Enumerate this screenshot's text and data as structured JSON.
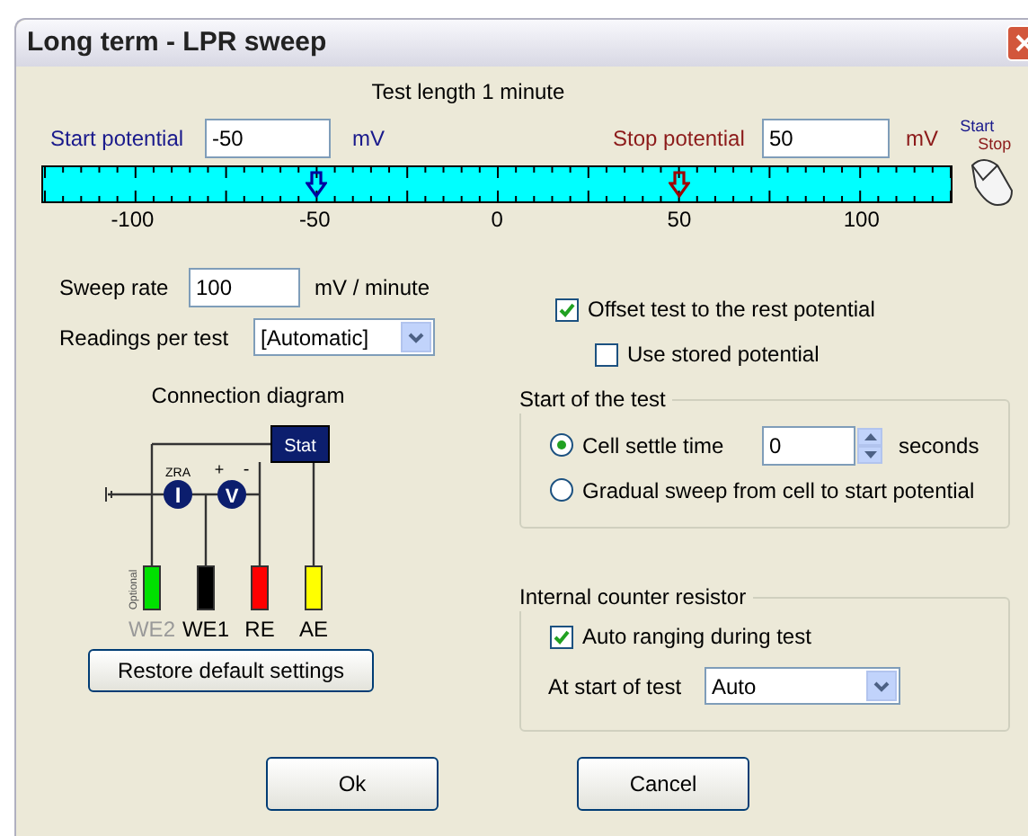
{
  "window": {
    "title": "Long term - LPR sweep"
  },
  "test_length": "Test length 1 minute",
  "start_potential": {
    "label": "Start potential",
    "value": "-50",
    "unit": "mV"
  },
  "stop_potential": {
    "label": "Stop potential",
    "value": "50",
    "unit": "mV"
  },
  "mouse_hint": {
    "start": "Start",
    "stop": "Stop"
  },
  "ruler": {
    "ticks": [
      "-100",
      "-50",
      "0",
      "50",
      "100"
    ],
    "markers": [
      {
        "level": 0.3,
        "color": "#0000a0"
      },
      {
        "level": 0.7,
        "color": "#a00000"
      }
    ]
  },
  "sweep_rate": {
    "label": "Sweep rate",
    "value": "100",
    "unit": "mV / minute"
  },
  "readings_per_test": {
    "label": "Readings per test",
    "value": "[Automatic]"
  },
  "connection_diagram": {
    "title": "Connection diagram",
    "stat": "Stat",
    "zra": "ZRA",
    "ammeter": "I",
    "voltmeter": "V",
    "plus": "+",
    "minus": "-",
    "optional": "Optional",
    "terminals": [
      {
        "label": "WE2",
        "color": "#00e000",
        "optional": true
      },
      {
        "label": "WE1",
        "color": "#000000",
        "optional": false
      },
      {
        "label": "RE",
        "color": "#ff0000",
        "optional": false
      },
      {
        "label": "AE",
        "color": "#ffff00",
        "optional": false
      }
    ]
  },
  "restore_button": "Restore default settings",
  "offset_test": {
    "label": "Offset test to the rest potential",
    "checked": true
  },
  "use_stored": {
    "label": "Use stored potential",
    "checked": false
  },
  "start_of_test": {
    "title": "Start of the test",
    "options": [
      {
        "kind": "settle",
        "label": "Cell settle time",
        "selected": true,
        "value": "0",
        "unit": "seconds"
      },
      {
        "kind": "plain",
        "label": "Gradual sweep from cell to start potential",
        "selected": false
      }
    ]
  },
  "counter_resistor": {
    "title": "Internal counter resistor",
    "auto_ranging": {
      "label": "Auto ranging during test",
      "checked": true
    },
    "at_start": {
      "label": "At start of test",
      "value": "Auto"
    }
  },
  "buttons": [
    "Ok",
    "Cancel"
  ]
}
